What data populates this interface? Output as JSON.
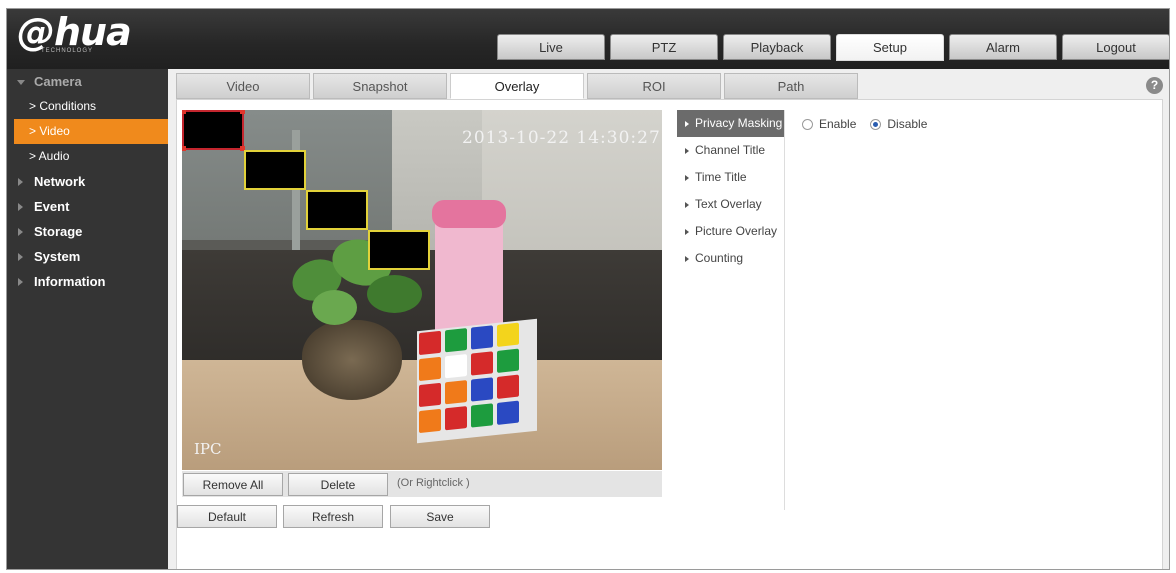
{
  "brand": {
    "logo": "alhua",
    "logo_sub": "TECHNOLOGY"
  },
  "top_nav": [
    {
      "label": "Live",
      "active": false
    },
    {
      "label": "PTZ",
      "active": false
    },
    {
      "label": "Playback",
      "active": false
    },
    {
      "label": "Setup",
      "active": true
    },
    {
      "label": "Alarm",
      "active": false
    },
    {
      "label": "Logout",
      "active": false
    }
  ],
  "sidebar": {
    "camera": "Camera",
    "conditions": "> Conditions",
    "video": "> Video",
    "audio": "> Audio",
    "network": "Network",
    "event": "Event",
    "storage": "Storage",
    "system": "System",
    "information": "Information"
  },
  "sub_tabs": [
    {
      "label": "Video",
      "active": false
    },
    {
      "label": "Snapshot",
      "active": false
    },
    {
      "label": "Overlay",
      "active": true
    },
    {
      "label": "ROI",
      "active": false
    },
    {
      "label": "Path",
      "active": false
    }
  ],
  "help": "?",
  "video": {
    "timestamp": "2013-10-22 14:30:27",
    "channel_name": "IPC"
  },
  "mask_toolbar": {
    "remove_all": "Remove All",
    "delete": "Delete",
    "hint": "(Or Rightclick )"
  },
  "actions": {
    "default": "Default",
    "refresh": "Refresh",
    "save": "Save"
  },
  "overlay_menu": [
    {
      "label": "Privacy Masking",
      "active": true
    },
    {
      "label": "Channel Title",
      "active": false
    },
    {
      "label": "Time Title",
      "active": false
    },
    {
      "label": "Text Overlay",
      "active": false
    },
    {
      "label": "Picture Overlay",
      "active": false
    },
    {
      "label": "Counting",
      "active": false
    }
  ],
  "privacy": {
    "enable_label": "Enable",
    "disable_label": "Disable",
    "selected": "Disable"
  },
  "colors": {
    "accent": "#f08a1c",
    "sidebar_bg": "#343434",
    "mask_border": "#e2d23a",
    "mask_selected_border": "#c4262e"
  }
}
